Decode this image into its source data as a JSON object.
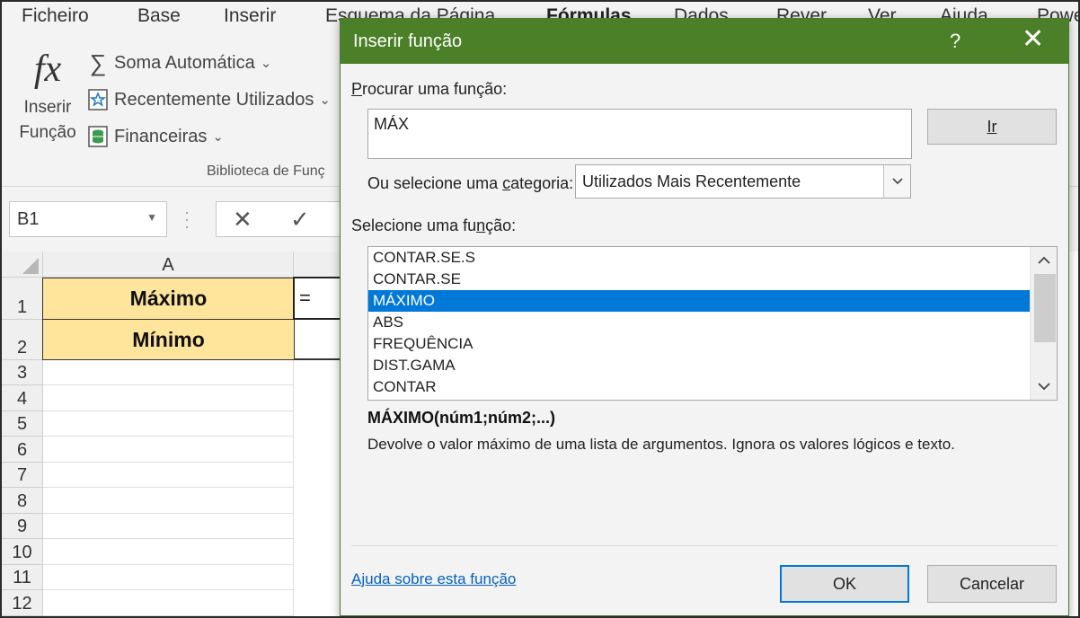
{
  "ribbon": {
    "tabs": [
      {
        "label": "Ficheiro",
        "active": false
      },
      {
        "label": "Base",
        "active": false
      },
      {
        "label": "Inserir",
        "active": false
      },
      {
        "label": "Esquema da Página",
        "active": false
      },
      {
        "label": "Fórmulas",
        "active": true
      },
      {
        "label": "Dados",
        "active": false
      },
      {
        "label": "Rever",
        "active": false
      },
      {
        "label": "Ver",
        "active": false
      },
      {
        "label": "Ajuda",
        "active": false
      },
      {
        "label": "Powe",
        "active": false
      }
    ],
    "insert_function": {
      "icon": "fx-icon",
      "line1": "Inserir",
      "line2": "Função"
    },
    "commands": [
      {
        "label": "Soma Automática",
        "icon": "sigma-icon"
      },
      {
        "label": "Recentemente Utilizados",
        "icon": "star-icon"
      },
      {
        "label": "Financeiras",
        "icon": "database-icon"
      }
    ],
    "group_label": "Biblioteca de Funç"
  },
  "formula_bar": {
    "name_box": "B1",
    "cancel_glyph": "✕",
    "enter_glyph": "✓"
  },
  "sheet": {
    "columns": [
      "A"
    ],
    "rows": [
      "1",
      "2",
      "3",
      "4",
      "5",
      "6",
      "7",
      "8",
      "9",
      "10",
      "11",
      "12"
    ],
    "cells": {
      "A1": "Máximo",
      "A2": "Mínimo",
      "B1": "="
    },
    "label_fill": "#ffe49b"
  },
  "dialog": {
    "title": "Inserir função",
    "help_glyph": "?",
    "close_glyph": "✕",
    "search_label_key": "P",
    "search_label_rest": "rocurar uma função:",
    "search_value": "MÁX",
    "go_button": "Ir",
    "category_label_pre": "Ou selecione uma ",
    "category_label_key": "c",
    "category_label_post": "ategoria:",
    "category_value": "Utilizados Mais Recentemente",
    "list_label_pre": "Selecione uma fu",
    "list_label_key": "n",
    "list_label_post": "ção:",
    "functions": [
      "CONTAR.SE.S",
      "CONTAR.SE",
      "MÁXIMO",
      "ABS",
      "FREQUÊNCIA",
      "DIST.GAMA",
      "CONTAR"
    ],
    "selected_function": "MÁXIMO",
    "syntax": "MÁXIMO(núm1;núm2;...)",
    "description": "Devolve o valor máximo de uma lista de argumentos. Ignora os valores lógicos e texto.",
    "help_link": "Ajuda sobre esta função",
    "ok_button": "OK",
    "cancel_button": "Cancelar",
    "title_bar_color": "#4b7f28",
    "selection_color": "#0078d7"
  }
}
